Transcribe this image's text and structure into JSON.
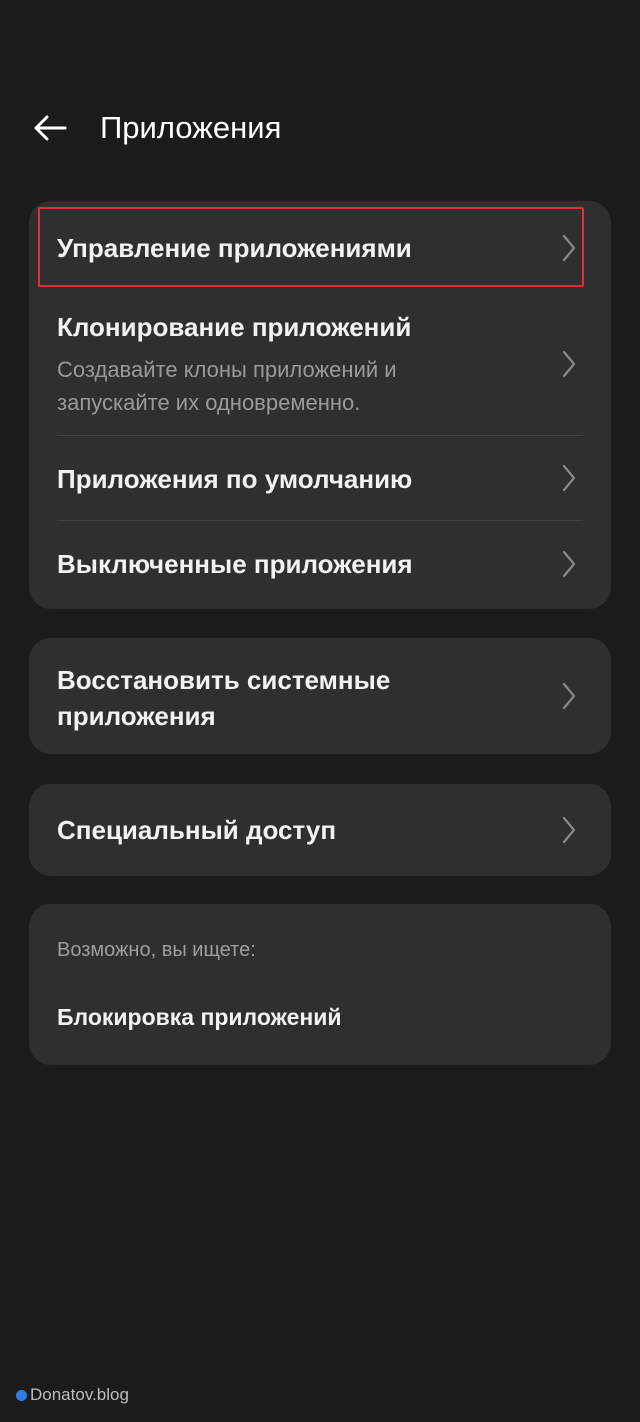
{
  "header": {
    "title": "Приложения",
    "back_icon": "arrow-left-icon"
  },
  "group1": {
    "items": [
      {
        "title": "Управление приложениями",
        "subtitle": ""
      },
      {
        "title": "Клонирование приложений",
        "subtitle_line1": "Создавайте клоны приложений и",
        "subtitle_line2": "запускайте их одновременно."
      },
      {
        "title": "Приложения по умолчанию",
        "subtitle": ""
      },
      {
        "title": "Выключенные приложения",
        "subtitle": ""
      }
    ]
  },
  "group2": {
    "item": {
      "title_line1": "Восстановить системные",
      "title_line2": "приложения"
    }
  },
  "group3": {
    "item": {
      "title": "Специальный доступ"
    }
  },
  "suggestions": {
    "label": "Возможно, вы ищете:",
    "link": "Блокировка приложений"
  },
  "watermark": {
    "text": "Donatov.blog"
  },
  "colors": {
    "background": "#1b1b1b",
    "card": "#2f2f2f",
    "highlight": "#e0303a",
    "watermark_dot": "#2f7de1"
  }
}
